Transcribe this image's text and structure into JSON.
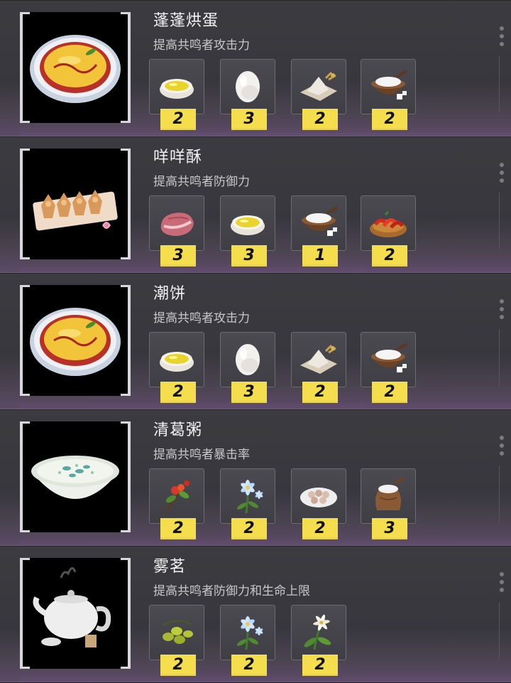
{
  "recipes": [
    {
      "name": "蓬蓬烘蛋",
      "effect": "提高共鸣者攻击力",
      "dish_icon": "omelette-plate-icon",
      "ingredients": [
        {
          "icon": "oil-bowl-icon",
          "qty": "2"
        },
        {
          "icon": "egg-icon",
          "qty": "3"
        },
        {
          "icon": "flour-pile-icon",
          "qty": "2"
        },
        {
          "icon": "salt-bowl-icon",
          "qty": "2"
        }
      ]
    },
    {
      "name": "咩咩酥",
      "effect": "提高共鸣者防御力",
      "dish_icon": "pastry-tray-icon",
      "ingredients": [
        {
          "icon": "meat-icon",
          "qty": "3"
        },
        {
          "icon": "oil-bowl-icon",
          "qty": "3"
        },
        {
          "icon": "salt-bowl-icon",
          "qty": "1"
        },
        {
          "icon": "chili-peppers-icon",
          "qty": "2"
        }
      ]
    },
    {
      "name": "潮饼",
      "effect": "提高共鸣者攻击力",
      "dish_icon": "omelette-plate-icon",
      "ingredients": [
        {
          "icon": "oil-bowl-icon",
          "qty": "2"
        },
        {
          "icon": "egg-icon",
          "qty": "3"
        },
        {
          "icon": "flour-pile-icon",
          "qty": "2"
        },
        {
          "icon": "salt-bowl-icon",
          "qty": "2"
        }
      ]
    },
    {
      "name": "清葛粥",
      "effect": "提高共鸣者暴击率",
      "dish_icon": "porridge-bowl-icon",
      "ingredients": [
        {
          "icon": "berry-sprig-icon",
          "qty": "2"
        },
        {
          "icon": "blue-flower-icon",
          "qty": "2"
        },
        {
          "icon": "seeds-plate-icon",
          "qty": "2"
        },
        {
          "icon": "flour-sack-icon",
          "qty": "3"
        }
      ]
    },
    {
      "name": "雾茗",
      "effect": "提高共鸣者防御力和生命上限",
      "dish_icon": "teapot-icon",
      "ingredients": [
        {
          "icon": "olives-icon",
          "qty": "2"
        },
        {
          "icon": "blue-flower-icon",
          "qty": "2"
        },
        {
          "icon": "lily-flower-icon",
          "qty": "2"
        }
      ]
    }
  ],
  "colors": {
    "qty_badge": "#f4de4e",
    "card_bg": "#3b3b40",
    "card_glow": "#5c4a66"
  }
}
